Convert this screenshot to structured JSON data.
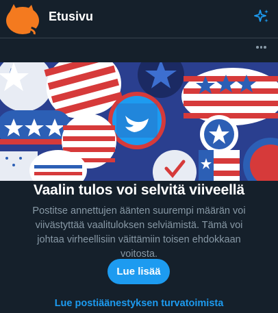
{
  "header": {
    "title": "Etusivu",
    "avatar_icon": "cat-silhouette-avatar",
    "sparkle_icon": "sparkle-icon",
    "avatar_color": "#f47a1f"
  },
  "card": {
    "more_icon": "more-icon",
    "banner_description_icon": "election-buttons-banner",
    "headline": "Vaalin tulos voi selvitä viiveellä",
    "body": "Postitse annettujen äänten suurempi määrän voi viivästyttää vaalituloksen selviämistä. Tämä voi johtaa virheellisiin väittämiin toisen ehdokkaan voitosta.",
    "cta_label": "Lue lisää",
    "link_label": "Lue postiäänestyksen turvatoimista"
  },
  "colors": {
    "background": "#15202b",
    "accent": "#1d9bf0",
    "muted_text": "#8899a6",
    "divider": "#38444d"
  }
}
